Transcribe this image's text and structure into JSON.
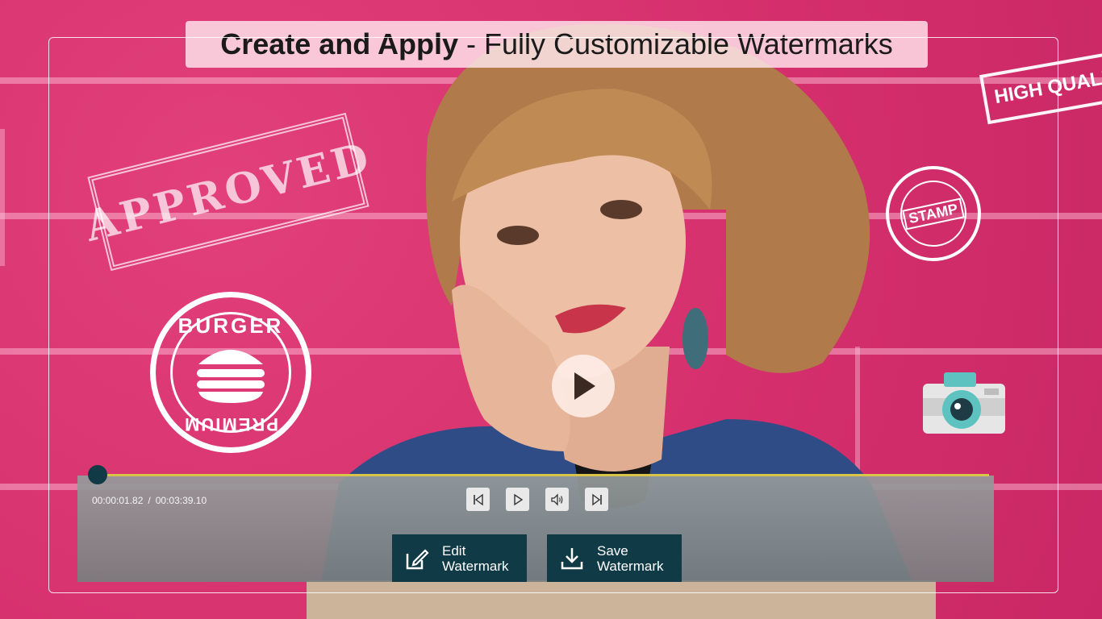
{
  "title": {
    "bold": "Create and Apply",
    "rest": "- Fully Customizable Watermarks"
  },
  "stamps": {
    "approved": "APPROVED",
    "high_quality": "HIGH QUALITY",
    "round_stamp": "STAMP",
    "burger_top": "BURGER",
    "burger_bottom": "PREMIUM"
  },
  "player": {
    "current_time": "00:00:01.82",
    "separator": "/",
    "total_time": "00:03:39.10",
    "progress": 0.01
  },
  "controls": {
    "prev": "skip-back-icon",
    "play": "play-icon",
    "volume": "volume-icon",
    "next": "skip-forward-icon"
  },
  "actions": {
    "edit": {
      "line1": "Edit",
      "line2": "Watermark"
    },
    "save": {
      "line1": "Save",
      "line2": "Watermark"
    }
  },
  "colors": {
    "background_pink": "#d8336f",
    "button_dark": "#0f3a46",
    "seek_track": "#d9c44a"
  }
}
